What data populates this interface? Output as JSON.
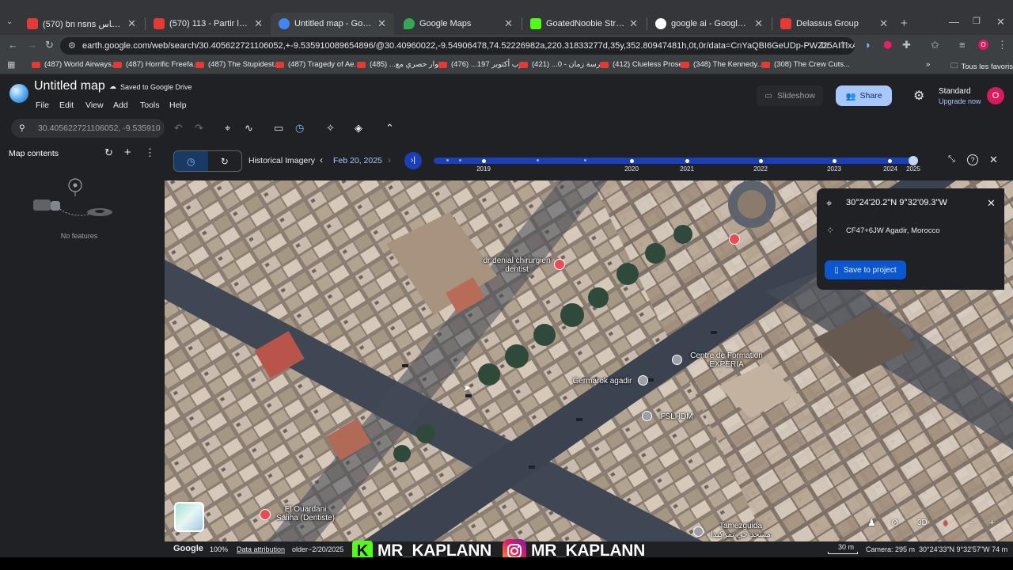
{
  "browser": {
    "tabs": [
      {
        "title": "(570) bn nsns بن نستاس - YouTube",
        "fav": "#e53935"
      },
      {
        "title": "(570) 113 - Partir loin (Clip officiel)",
        "fav": "#e53935"
      },
      {
        "title": "Untitled map - Google Earth",
        "fav": "#4285f4"
      },
      {
        "title": "Google Maps",
        "fav": "#34a853"
      },
      {
        "title": "GoatedNoobie Stream - Watch",
        "fav": "#53fc18"
      },
      {
        "title": "google ai - Google Search",
        "fav": "#ffffff"
      },
      {
        "title": "Delassus Group",
        "fav": "#e53935"
      }
    ],
    "url": "earth.google.com/web/search/30.405622721106052,+-9.535910089654896/@30.40960022,-9.54906478,74.52226982a,220.31833277d,35y,352.80947481h,0t,0r/data=CnYaQBI6GeUDp-PWZz5AITlxAs9EiPAKiYzMC40MDU2Mj...",
    "bookmarks": [
      "(487) World Airways...",
      "(487) Horrific Freefa...",
      "(487) The Stupidest...",
      "(487) Tragedy of Ae...",
      "حوار حصري مع... (485)",
      "حرب أكتوبر 197... (476)",
      "مدرسة زمان - 0... (421)",
      "(412) Clueless Prose...",
      "(348) The Kennedy...",
      "(308) The Crew Cuts..."
    ],
    "all_bookmarks": "Tous les favoris"
  },
  "app": {
    "title": "Untitled map",
    "saved": "Saved to Google Drive",
    "menu": [
      "File",
      "Edit",
      "View",
      "Add",
      "Tools",
      "Help"
    ],
    "slideshow": "Slideshow",
    "share": "Share",
    "plan": "Standard",
    "upgrade": "Upgrade now",
    "avatar": "O",
    "search_value": "30.405622721106052, -9.535910"
  },
  "panel": {
    "title": "Map contents",
    "empty": "No features"
  },
  "history": {
    "label": "Historical Imagery",
    "date": "Feb 20, 2025",
    "years": [
      "2019",
      "2020",
      "2021",
      "2022",
      "2023",
      "2024",
      "2025"
    ]
  },
  "location": {
    "coords": "30°24'20.2\"N 9°32'09.3\"W",
    "plus_code": "CF47+6JW Agadir, Morocco",
    "save": "Save to project"
  },
  "map_labels": {
    "dentist1": "dr denial chirurgien dentist",
    "training": "Centre de Formation EXPERIA",
    "germarok": "Germarok agadir",
    "fslhdm": "FSLHDM",
    "dentist2": "El Ouardani Saliha (Dentiste)",
    "mosque": "Tamezguida مسجد حي تمزكيدا"
  },
  "status": {
    "brand": "Google",
    "zoom": "100%",
    "attribution": "Data attribution",
    "imagery": "older~2/20/2025",
    "scale": "30 m",
    "camera": "Camera: 295 m",
    "cursor": "30°24'33\"N 9°32'57\"W  74 m",
    "ctrl_3d": "3D"
  },
  "watermark": {
    "kick": "MR_KAPLANN",
    "instagram": "MR_KAPLANN"
  }
}
